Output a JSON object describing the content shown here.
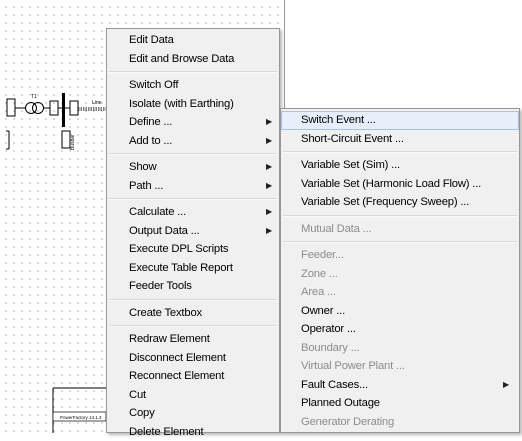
{
  "canvas": {
    "line_label": "Line",
    "bus_label": "Busbar",
    "status_text": "PowerFactory 14.1.3"
  },
  "context_menu": {
    "items": [
      {
        "label": "Edit Data"
      },
      {
        "label": "Edit and Browse Data"
      },
      {
        "label": "Switch Off"
      },
      {
        "label": "Isolate (with Earthing)"
      },
      {
        "label": "Define ...",
        "submenu": true
      },
      {
        "label": "Add to ...",
        "submenu": true
      },
      {
        "label": "Show",
        "submenu": true
      },
      {
        "label": "Path ...",
        "submenu": true
      },
      {
        "label": "Calculate ...",
        "submenu": true
      },
      {
        "label": "Output Data ...",
        "submenu": true
      },
      {
        "label": "Execute DPL Scripts"
      },
      {
        "label": "Execute Table Report"
      },
      {
        "label": "Feeder Tools"
      },
      {
        "label": "Create Textbox"
      },
      {
        "label": "Redraw Element"
      },
      {
        "label": "Disconnect Element"
      },
      {
        "label": "Reconnect Element"
      },
      {
        "label": "Cut"
      },
      {
        "label": "Copy"
      },
      {
        "label": "Delete Element"
      }
    ],
    "submenu_arrow": "▶"
  },
  "define_submenu": {
    "items": [
      {
        "label": "Switch Event ...",
        "state": "highlighted"
      },
      {
        "label": "Short-Circuit Event ..."
      },
      {
        "label": "Variable Set (Sim) ..."
      },
      {
        "label": "Variable Set (Harmonic Load Flow) ..."
      },
      {
        "label": "Variable Set (Frequency Sweep) ..."
      },
      {
        "label": "Mutual Data ...",
        "state": "disabled"
      },
      {
        "label": "Feeder...",
        "state": "disabled"
      },
      {
        "label": "Zone ...",
        "state": "disabled"
      },
      {
        "label": "Area ...",
        "state": "disabled"
      },
      {
        "label": "Owner ..."
      },
      {
        "label": "Operator ..."
      },
      {
        "label": "Boundary ...",
        "state": "disabled"
      },
      {
        "label": "Virtual Power Plant ...",
        "state": "disabled"
      },
      {
        "label": "Fault Cases...",
        "submenu": true
      },
      {
        "label": "Planned Outage"
      },
      {
        "label": "Generator Derating",
        "state": "disabled"
      }
    ]
  },
  "colors": {
    "menu_bg": "#f0f0f0",
    "highlight_bg": "#e5eef9",
    "highlight_border": "#a9c2e3",
    "disabled_text": "#8d8d8d"
  }
}
